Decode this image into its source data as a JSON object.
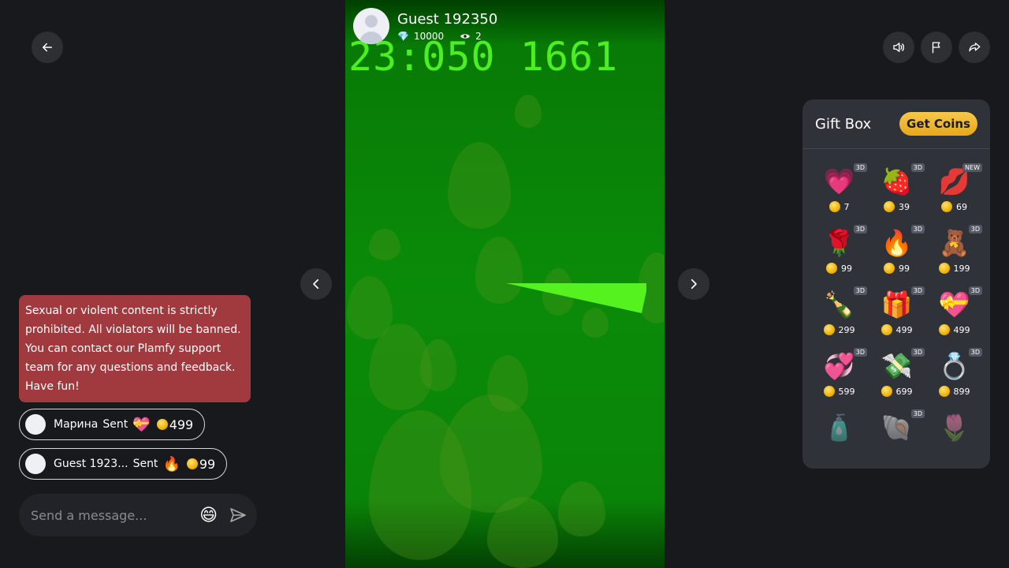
{
  "streamer": {
    "name": "Guest 192350",
    "diamonds": "10000",
    "viewers": "2"
  },
  "video": {
    "timer_text": "23:050 1661"
  },
  "notice": {
    "text": "Sexual or violent content is strictly prohibited. All violators will be banned. You can contact our Plamfy support team for any questions and feedback. Have fun!"
  },
  "gift_messages": [
    {
      "user": "Марина",
      "action": "Sent",
      "gift_icon": "heart-lock-icon",
      "gift_glyph": "💝",
      "amount": "499"
    },
    {
      "user": "Guest 1923...",
      "action": "Sent",
      "gift_icon": "fire-icon",
      "gift_glyph": "🔥",
      "amount": "99"
    }
  ],
  "message_box": {
    "placeholder": "Send a message..."
  },
  "gift_box": {
    "title": "Gift Box",
    "get_coins": "Get Coins",
    "items": [
      {
        "name": "follow-me-heart",
        "glyph": "💗",
        "price": "7",
        "badge": "3D"
      },
      {
        "name": "chocolate-strawberry",
        "glyph": "🍓",
        "price": "39",
        "badge": "3D"
      },
      {
        "name": "lips",
        "glyph": "💋",
        "price": "69",
        "badge": "NEW"
      },
      {
        "name": "rose",
        "glyph": "🌹",
        "price": "99",
        "badge": "3D"
      },
      {
        "name": "fire",
        "glyph": "🔥",
        "price": "99",
        "badge": "3D"
      },
      {
        "name": "teddy-bear",
        "glyph": "🧸",
        "price": "199",
        "badge": "3D"
      },
      {
        "name": "champagne",
        "glyph": "🍾",
        "price": "299",
        "badge": "3D"
      },
      {
        "name": "heart-chocolate-box",
        "glyph": "🎁",
        "price": "499",
        "badge": "3D"
      },
      {
        "name": "heart-lock",
        "glyph": "💝",
        "price": "499",
        "badge": "3D"
      },
      {
        "name": "hearts-balloons",
        "glyph": "💞",
        "price": "599",
        "badge": "3D"
      },
      {
        "name": "money-stack",
        "glyph": "💸",
        "price": "699",
        "badge": "3D"
      },
      {
        "name": "diamond-ring",
        "glyph": "💍",
        "price": "899",
        "badge": "3D"
      },
      {
        "name": "perfume",
        "glyph": "🧴",
        "price": "",
        "badge": ""
      },
      {
        "name": "pearl-shell",
        "glyph": "🐚",
        "price": "",
        "badge": "3D"
      },
      {
        "name": "tulips",
        "glyph": "🌷",
        "price": "",
        "badge": ""
      }
    ]
  },
  "colors": {
    "background": "#18191c",
    "notice": "#a03a3e",
    "panel": "#2f3239",
    "accent_gold": "#f7c84a",
    "timer_green": "#4cf021"
  },
  "icons": {
    "back": "arrow-left-icon",
    "sound": "speaker-icon",
    "report": "flag-icon",
    "share": "share-icon",
    "prev": "chevron-left-icon",
    "next": "chevron-right-icon",
    "emoji": "emoji-icon",
    "send": "send-icon"
  }
}
